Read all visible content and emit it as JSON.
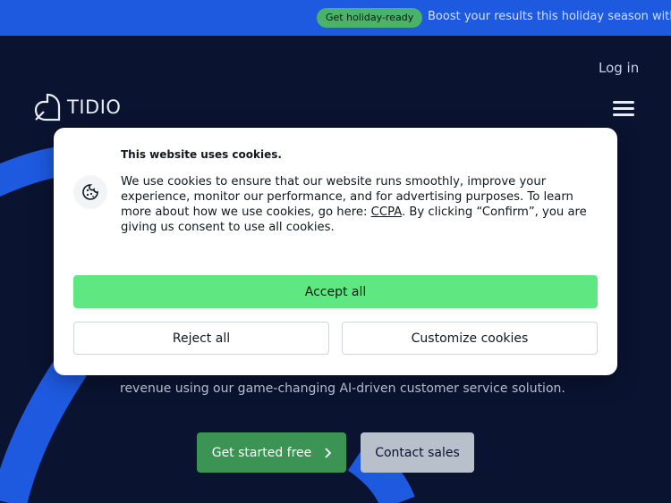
{
  "promo": {
    "badge": "Get holiday-ready",
    "text": "Boost your results this holiday season with a free"
  },
  "header": {
    "login": "Log in",
    "logo_text": "TIDIO"
  },
  "hero": {
    "subtitle_line": "revenue using our game-changing AI-driven customer service solution.",
    "cta_primary": "Get started free",
    "cta_secondary": "Contact sales"
  },
  "cookie": {
    "title": "This website uses cookies.",
    "body_before_link": "We use cookies to ensure that our website runs smoothly, improve your experience, monitor our performance, and for advertising purposes. To learn more about how we use cookies, go here: ",
    "link": "CCPA",
    "body_after_link": ". By clicking “Confirm”, you are giving us consent to use all cookies.",
    "accept": "Accept all",
    "reject": "Reject all",
    "customize": "Customize cookies"
  },
  "colors": {
    "promo_bg": "#1e5ae0",
    "hero_bg": "#0a1330",
    "accept_bg": "#5fe882",
    "cta_primary_bg": "#3b9454"
  }
}
